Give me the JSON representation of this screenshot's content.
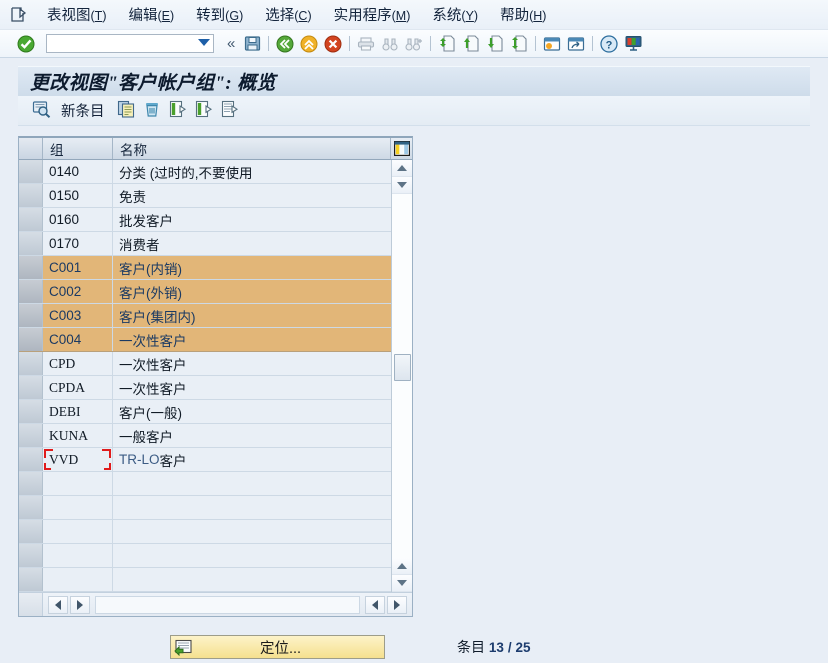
{
  "window": {
    "doc_icon": "document-edit-icon"
  },
  "menubar": {
    "items": [
      {
        "label": "表视图",
        "accel": "T"
      },
      {
        "label": "编辑",
        "accel": "E"
      },
      {
        "label": "转到",
        "accel": "G"
      },
      {
        "label": "选择",
        "accel": "C"
      },
      {
        "label": "实用程序",
        "accel": "M"
      },
      {
        "label": "系统",
        "accel": "Y"
      },
      {
        "label": "帮助",
        "accel": "H"
      }
    ]
  },
  "system_toolbar": {
    "enter_icon": "green-check-enter-icon",
    "command_field": {
      "value": "",
      "placeholder": ""
    },
    "collapse_icon": "double-chevron-left-icon",
    "icons": [
      "save-disk-icon",
      "back-green-icon",
      "exit-yellow-up-icon",
      "cancel-red-x-icon",
      "print-icon",
      "find-binoculars-icon",
      "find-next-binoculars-plus-icon",
      "first-page-icon",
      "previous-page-icon",
      "next-page-icon",
      "last-page-icon",
      "create-session-icon",
      "create-shortcut-icon",
      "help-question-icon",
      "customize-local-layout-icon"
    ]
  },
  "title": {
    "text": "更改视图\"客户帐户组\": 概览"
  },
  "app_toolbar": {
    "display_icon": "display-magnifier-icon",
    "new_entries_label": "新条目",
    "icons": [
      "copy-as-icon",
      "delete-trash-icon",
      "undo-change-icon",
      "select-all-icon",
      "deselect-all-icon"
    ]
  },
  "grid": {
    "columns": [
      {
        "key": "group",
        "header": "组"
      },
      {
        "key": "name",
        "header": "名称"
      }
    ],
    "config_icon": "table-settings-icon",
    "focused_cell": {
      "row": 12,
      "column": "group"
    },
    "rows": [
      {
        "group": "0140",
        "name": "分类 (过时的,不要使用",
        "selected": false
      },
      {
        "group": "0150",
        "name": "免责",
        "selected": false
      },
      {
        "group": "0160",
        "name": "批发客户",
        "selected": false
      },
      {
        "group": "0170",
        "name": "消费者",
        "selected": false
      },
      {
        "group": "C001",
        "name": "客户(内销)",
        "selected": true
      },
      {
        "group": "C002",
        "name": "客户(外销)",
        "selected": true
      },
      {
        "group": "C003",
        "name": "客户(集团内)",
        "selected": true
      },
      {
        "group": "C004",
        "name": "一次性客户",
        "selected": true
      },
      {
        "group": "CPD",
        "name": "一次性客户",
        "selected": false
      },
      {
        "group": "CPDA",
        "name": "一次性客户",
        "selected": false
      },
      {
        "group": "DEBI",
        "name": "客户(一般)",
        "selected": false
      },
      {
        "group": "KUNA",
        "name": "一般客户",
        "selected": false
      },
      {
        "group": "VVD",
        "name": "TR-LO 客户",
        "selected": false
      },
      {
        "group": "",
        "name": "",
        "selected": false
      },
      {
        "group": "",
        "name": "",
        "selected": false
      },
      {
        "group": "",
        "name": "",
        "selected": false
      },
      {
        "group": "",
        "name": "",
        "selected": false
      },
      {
        "group": "",
        "name": "",
        "selected": false
      }
    ],
    "vertical_scrollbar": {
      "thumb_top_pct": 44
    },
    "horizontal_scrollbar": {
      "left_arrow": "◀",
      "right_arrow": "▶"
    }
  },
  "footer": {
    "position_button": {
      "label": "定位...",
      "icon": "position-goto-icon"
    },
    "entry_counter": {
      "prefix": "条目",
      "current": "13",
      "separator": "/",
      "total": "25"
    }
  },
  "colors": {
    "highlight_row": "#e2b678",
    "highlight_text": "#1b3a63",
    "cell_bg": "#e9eff6",
    "button_yellow": "#f5e08e",
    "page_bg": "#e8eef6",
    "focus_red": "#e01b1b"
  }
}
